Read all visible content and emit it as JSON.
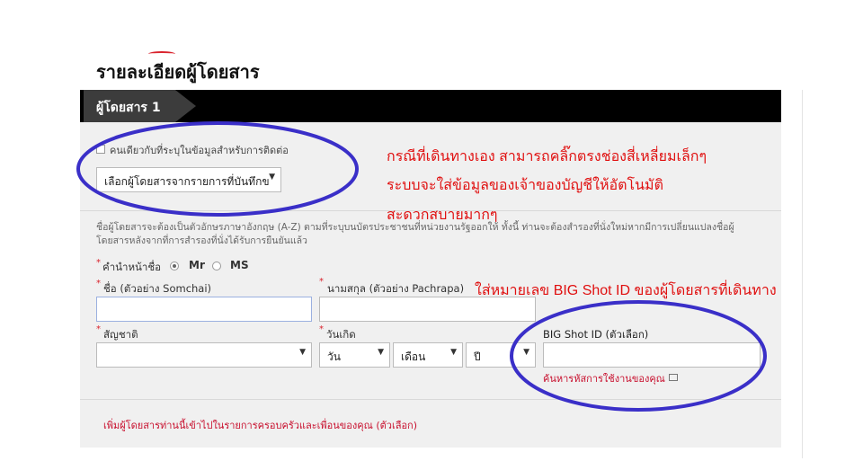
{
  "page": {
    "title": "รายละเอียดผู้โดยสาร"
  },
  "passenger": {
    "tab_label": "ผู้โดยสาร 1",
    "same_contact_label": "คนเดียวกับที่ระบุในข้อมูลสำหรับการติดต่อ",
    "saved_select": {
      "value": "เลือกผู้โดยสารจากรายการที่บันทึกข"
    },
    "name_note": "ชื่อผู้โดยสารจะต้องเป็นตัวอักษรภาษาอังกฤษ (A-Z) ตามที่ระบุบนบัตรประชาชนที่หน่วยงานรัฐออกให้ ทั้งนี้ ท่านจะต้องสำรองที่นั่งใหม่หากมีการเปลี่ยนแปลงชื่อผู้โดยสารหลังจากที่การสำรองที่นั่งได้รับการยืนยันแล้ว",
    "required_mark": "*",
    "title_label": "คำนำหน้าชื่อ",
    "title_options": [
      {
        "label": "Mr",
        "selected": true
      },
      {
        "label": "MS",
        "selected": false
      }
    ],
    "first_name": {
      "label": "ชื่อ (ตัวอย่าง Somchai)",
      "value": ""
    },
    "last_name": {
      "label": "นามสกุล (ตัวอย่าง Pachrapa)",
      "value": ""
    },
    "nationality": {
      "label": "สัญชาติ",
      "value": ""
    },
    "birthdate": {
      "label": "วันเกิด",
      "day": "วัน",
      "month": "เดือน",
      "year": "ปี"
    },
    "bigshot": {
      "label": "BIG Shot ID (ตัวเลือก)",
      "value": "",
      "link": "ค้นหารหัสการใช้งานของคุณ"
    },
    "add_family": "เพิ่มผู้โดยสารท่านนี้เข้าไปในรายการครอบครัวและเพื่อนของคุณ (ตัวเลือก)"
  },
  "annotations": {
    "line1": "กรณีที่เดินทางเอง สามารถคลิ๊กตรงช่องสี่เหลี่ยมเล็กๆ",
    "line2": "ระบบจะใส่ข้อมูลของเจ้าของบัญชีให้อัตโนมัติ",
    "line3": "สะดวกสบายมากๆ",
    "line4": "ใส่หมายเลข BIG Shot ID ของผู้โดยสารที่เดินทาง"
  },
  "colors": {
    "accent": "#c8102e",
    "annotation": "#e01010",
    "oval": "#3a2fc8",
    "header": "#000000"
  },
  "icons": {
    "dropdown": "caret-down-icon",
    "external": "external-link-icon"
  }
}
